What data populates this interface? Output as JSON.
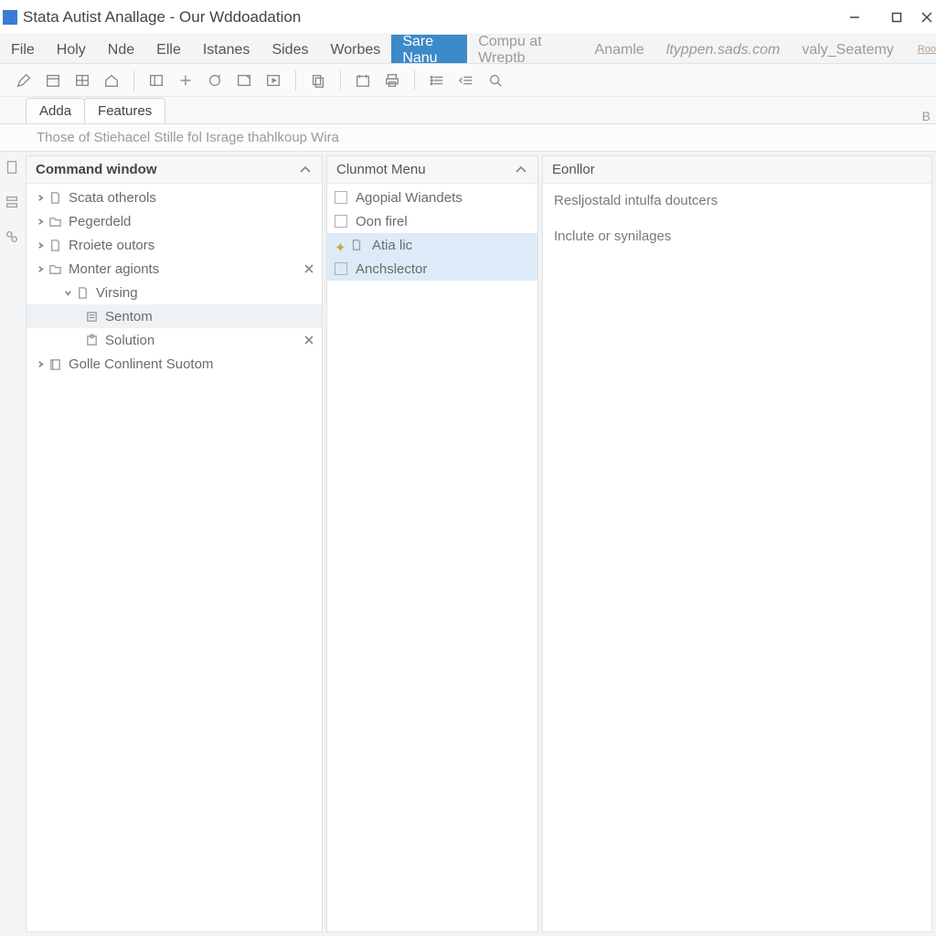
{
  "title": "Stata Autist Anallage - Our Wddoadation",
  "menus": {
    "items": [
      "File",
      "Holy",
      "Nde",
      "Elle",
      "Istanes",
      "Sides",
      "Worbes"
    ],
    "highlighted": "Sare Nanu",
    "trail1": "Compu at Wreptb_",
    "trail2": "Anamle",
    "trail3": "ltyppen.sads.com",
    "trail4": "valy_Seatemy",
    "tiny": "Roo"
  },
  "tabs": {
    "tab1": "Adda",
    "tab2": "Features",
    "right": "B"
  },
  "hint": "Those of Stiehacel Stille fol Israge   thahlkoup Wira",
  "panels": {
    "command": {
      "title": "Command window",
      "tree": [
        {
          "label": "Scata otherols"
        },
        {
          "label": "Pegerdeld"
        },
        {
          "label": "Rroiete outors"
        },
        {
          "label": "Monter agionts"
        },
        {
          "label": "Virsing"
        },
        {
          "label": "Sentom"
        },
        {
          "label": "Solution"
        },
        {
          "label": "Golle Conlinent Suotom"
        }
      ]
    },
    "menu": {
      "title": "Clunmot Menu",
      "items": [
        {
          "label": "Agopial Wiandets"
        },
        {
          "label": "Oon firel"
        },
        {
          "label": "Atia lic"
        },
        {
          "label": "Anchslector"
        }
      ]
    },
    "editor": {
      "title": "Eonllor",
      "line1": "Resljostald intulfa doutcers",
      "line2": "Inclute or synilages"
    }
  }
}
